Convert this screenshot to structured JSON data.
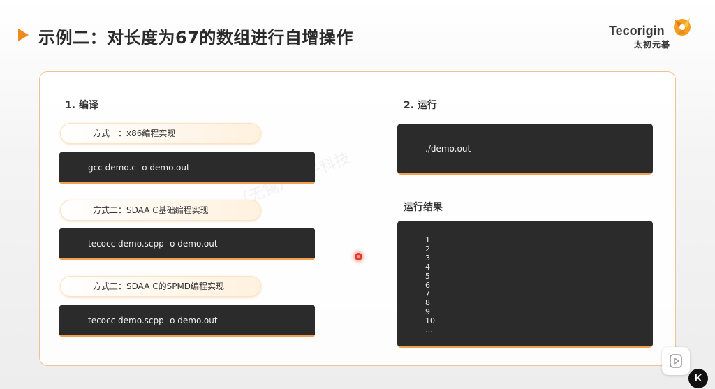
{
  "header": {
    "title": "示例二：对长度为67的数组进行自增操作",
    "arrow_icon": "play-triangle-icon",
    "accent_color": "#f08a1c"
  },
  "logo": {
    "name": "Tecorigin",
    "subtitle": "太初元碁",
    "mark_icon": "orange-flame-logo"
  },
  "compile": {
    "heading": "1.  编译",
    "methods": [
      {
        "label": "方式一：x86编程实现",
        "command": "gcc demo.c -o demo.out"
      },
      {
        "label": "方式二：SDAA C基础编程实现",
        "command": "tecocc demo.scpp -o demo.out"
      },
      {
        "label": "方式三：SDAA C的SPMD编程实现",
        "command": "tecocc demo.scpp -o demo.out"
      }
    ]
  },
  "run": {
    "heading": "2.  运行",
    "command": "./demo.out"
  },
  "result": {
    "heading": "运行结果",
    "lines": [
      "1",
      "2",
      "3",
      "4",
      "5",
      "6",
      "7",
      "8",
      "9",
      "10",
      "..."
    ]
  },
  "watermark": "（无锡）电子科技",
  "player": {
    "play_icon": "play-icon",
    "badge": "K"
  }
}
